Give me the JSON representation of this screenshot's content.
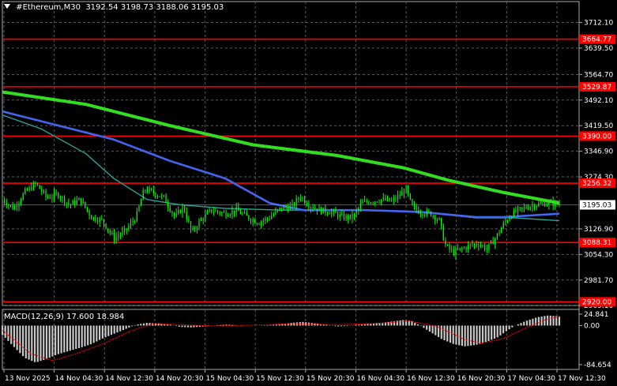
{
  "header": {
    "symbol_tf": "#Ethereum,M30",
    "ohlc": "3192.54 3198.73 3188.06 3195.03"
  },
  "macd": {
    "label": "MACD(12,26,9) 17.600 18.984"
  },
  "colors": {
    "background": "#000000",
    "grid": "#5a5a5a",
    "candle": "#00ff00",
    "ma_slow": "#33dd22",
    "ma_mid": "#4466ee",
    "ma_fast": "#2aa198",
    "level_line": "#ff0000",
    "level_tag": "#ff0000",
    "current_tag": "#ffffff",
    "macd_hist": "#c8c8c8",
    "macd_signal": "#ff0000"
  },
  "chart_data": {
    "type": "candlestick",
    "ylim": [
      2909.6,
      3740.0
    ],
    "y_ticks": [
      "3712.10",
      "3639.50",
      "3564.70",
      "3492.10",
      "3419.50",
      "3346.90",
      "3274.30",
      "3126.90",
      "3054.30",
      "2981.70",
      "2909.10"
    ],
    "x_ticks": [
      "13 Nov 2025",
      "14 Nov 04:30",
      "14 Nov 12:30",
      "14 Nov 20:30",
      "15 Nov 04:30",
      "15 Nov 12:30",
      "15 Nov 20:30",
      "16 Nov 04:30",
      "16 Nov 12:30",
      "16 Nov 20:30",
      "17 Nov 04:30",
      "17 Nov 12:30"
    ],
    "levels": [
      {
        "value": 3664.77,
        "label": "3664.77"
      },
      {
        "value": 3529.87,
        "label": "3529.87"
      },
      {
        "value": 3390.0,
        "label": "3390.00"
      },
      {
        "value": 3256.32,
        "label": "3256.32"
      },
      {
        "value": 3088.31,
        "label": "3088.31"
      },
      {
        "value": 2920.0,
        "label": "2920.00"
      }
    ],
    "current_price": {
      "value": 3195.03,
      "label": "3195.03"
    },
    "price_path": [
      [
        0.0,
        3210
      ],
      [
        0.02,
        3185
      ],
      [
        0.04,
        3230
      ],
      [
        0.06,
        3255
      ],
      [
        0.08,
        3215
      ],
      [
        0.1,
        3225
      ],
      [
        0.12,
        3195
      ],
      [
        0.14,
        3210
      ],
      [
        0.16,
        3160
      ],
      [
        0.18,
        3150
      ],
      [
        0.2,
        3100
      ],
      [
        0.22,
        3120
      ],
      [
        0.24,
        3160
      ],
      [
        0.255,
        3240
      ],
      [
        0.27,
        3230
      ],
      [
        0.29,
        3215
      ],
      [
        0.31,
        3160
      ],
      [
        0.325,
        3190
      ],
      [
        0.34,
        3115
      ],
      [
        0.355,
        3150
      ],
      [
        0.375,
        3180
      ],
      [
        0.4,
        3170
      ],
      [
        0.42,
        3180
      ],
      [
        0.44,
        3160
      ],
      [
        0.46,
        3145
      ],
      [
        0.48,
        3160
      ],
      [
        0.5,
        3185
      ],
      [
        0.52,
        3190
      ],
      [
        0.535,
        3220
      ],
      [
        0.55,
        3195
      ],
      [
        0.57,
        3180
      ],
      [
        0.59,
        3175
      ],
      [
        0.61,
        3160
      ],
      [
        0.63,
        3160
      ],
      [
        0.645,
        3200
      ],
      [
        0.66,
        3205
      ],
      [
        0.68,
        3210
      ],
      [
        0.7,
        3205
      ],
      [
        0.715,
        3225
      ],
      [
        0.725,
        3240
      ],
      [
        0.735,
        3190
      ],
      [
        0.75,
        3175
      ],
      [
        0.77,
        3170
      ],
      [
        0.785,
        3150
      ],
      [
        0.795,
        3080
      ],
      [
        0.81,
        3060
      ],
      [
        0.825,
        3070
      ],
      [
        0.84,
        3080
      ],
      [
        0.855,
        3085
      ],
      [
        0.87,
        3070
      ],
      [
        0.885,
        3100
      ],
      [
        0.9,
        3140
      ],
      [
        0.915,
        3170
      ],
      [
        0.935,
        3185
      ],
      [
        0.955,
        3195
      ],
      [
        0.975,
        3200
      ],
      [
        1.0,
        3198
      ]
    ],
    "ma_slow": [
      [
        0.0,
        3515
      ],
      [
        0.15,
        3480
      ],
      [
        0.3,
        3420
      ],
      [
        0.45,
        3365
      ],
      [
        0.6,
        3335
      ],
      [
        0.72,
        3300
      ],
      [
        0.8,
        3265
      ],
      [
        0.9,
        3230
      ],
      [
        1.0,
        3200
      ]
    ],
    "ma_mid": [
      [
        0.0,
        3460
      ],
      [
        0.1,
        3420
      ],
      [
        0.2,
        3380
      ],
      [
        0.3,
        3320
      ],
      [
        0.4,
        3270
      ],
      [
        0.48,
        3200
      ],
      [
        0.54,
        3180
      ],
      [
        0.65,
        3180
      ],
      [
        0.75,
        3175
      ],
      [
        0.85,
        3160
      ],
      [
        0.9,
        3160
      ],
      [
        1.0,
        3170
      ]
    ],
    "ma_fast": [
      [
        0.0,
        3450
      ],
      [
        0.07,
        3410
      ],
      [
        0.15,
        3340
      ],
      [
        0.2,
        3270
      ],
      [
        0.26,
        3210
      ],
      [
        0.32,
        3195
      ],
      [
        0.4,
        3185
      ],
      [
        0.5,
        3180
      ],
      [
        0.6,
        3180
      ],
      [
        0.7,
        3178
      ],
      [
        0.78,
        3170
      ],
      [
        0.85,
        3158
      ],
      [
        0.92,
        3158
      ],
      [
        1.0,
        3150
      ]
    ],
    "macd": {
      "ylim": [
        -95,
        35
      ],
      "y_ticks": [
        "24.841",
        "0.00",
        "-84.654"
      ],
      "hist": [
        [
          0.0,
          -20
        ],
        [
          0.02,
          -45
        ],
        [
          0.04,
          -70
        ],
        [
          0.06,
          -80
        ],
        [
          0.08,
          -72
        ],
        [
          0.1,
          -62
        ],
        [
          0.12,
          -55
        ],
        [
          0.14,
          -48
        ],
        [
          0.16,
          -40
        ],
        [
          0.18,
          -28
        ],
        [
          0.2,
          -18
        ],
        [
          0.22,
          -8
        ],
        [
          0.24,
          2
        ],
        [
          0.26,
          6
        ],
        [
          0.28,
          5
        ],
        [
          0.3,
          2
        ],
        [
          0.32,
          -3
        ],
        [
          0.34,
          -4
        ],
        [
          0.36,
          -2
        ],
        [
          0.38,
          0
        ],
        [
          0.4,
          2
        ],
        [
          0.42,
          1
        ],
        [
          0.44,
          0
        ],
        [
          0.46,
          0
        ],
        [
          0.48,
          1
        ],
        [
          0.5,
          3
        ],
        [
          0.52,
          6
        ],
        [
          0.54,
          8
        ],
        [
          0.56,
          5
        ],
        [
          0.58,
          2
        ],
        [
          0.6,
          -2
        ],
        [
          0.62,
          -1
        ],
        [
          0.64,
          2
        ],
        [
          0.66,
          4
        ],
        [
          0.68,
          6
        ],
        [
          0.7,
          9
        ],
        [
          0.72,
          12
        ],
        [
          0.735,
          10
        ],
        [
          0.75,
          0
        ],
        [
          0.77,
          -15
        ],
        [
          0.79,
          -30
        ],
        [
          0.81,
          -40
        ],
        [
          0.83,
          -45
        ],
        [
          0.85,
          -42
        ],
        [
          0.87,
          -35
        ],
        [
          0.89,
          -25
        ],
        [
          0.905,
          -12
        ],
        [
          0.92,
          0
        ],
        [
          0.94,
          10
        ],
        [
          0.96,
          18
        ],
        [
          0.98,
          22
        ],
        [
          1.0,
          20
        ]
      ],
      "signal": [
        [
          0.0,
          -10
        ],
        [
          0.05,
          -60
        ],
        [
          0.09,
          -76
        ],
        [
          0.13,
          -62
        ],
        [
          0.18,
          -40
        ],
        [
          0.23,
          -12
        ],
        [
          0.27,
          4
        ],
        [
          0.32,
          2
        ],
        [
          0.38,
          -1
        ],
        [
          0.45,
          1
        ],
        [
          0.52,
          4
        ],
        [
          0.6,
          2
        ],
        [
          0.68,
          5
        ],
        [
          0.73,
          10
        ],
        [
          0.78,
          -2
        ],
        [
          0.83,
          -30
        ],
        [
          0.86,
          -38
        ],
        [
          0.9,
          -28
        ],
        [
          0.94,
          -5
        ],
        [
          0.98,
          15
        ],
        [
          1.0,
          19
        ]
      ]
    }
  }
}
